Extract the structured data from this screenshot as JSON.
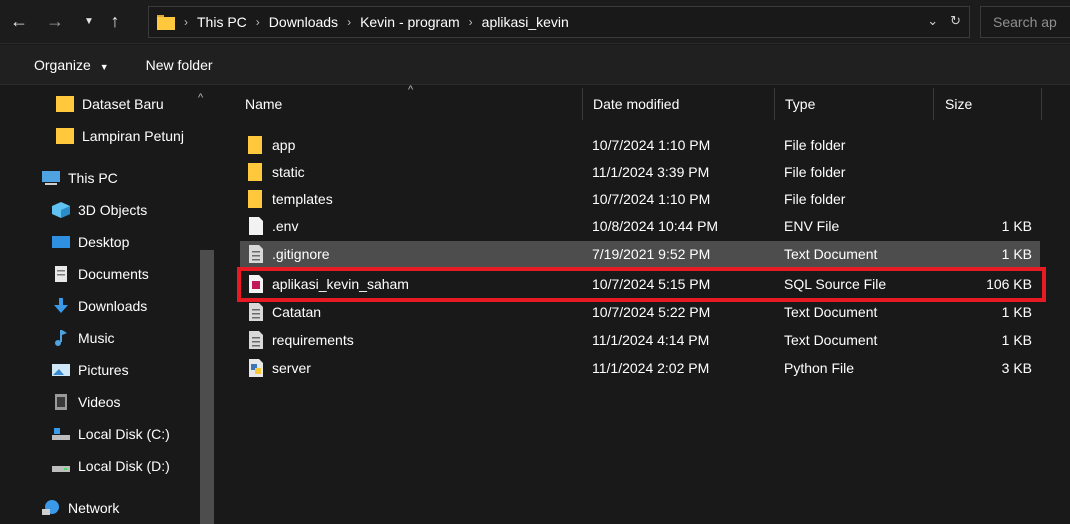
{
  "address": {
    "crumbs": [
      "This PC",
      "Downloads",
      "Kevin - program",
      "aplikasi_kevin"
    ],
    "search_placeholder": "Search ap"
  },
  "commands": {
    "organize": "Organize",
    "new_folder": "New folder"
  },
  "sidebar": {
    "items": [
      {
        "label": "Dataset Baru",
        "icon": "folder-icon"
      },
      {
        "label": "Lampiran Petunj",
        "icon": "folder-icon"
      },
      {
        "label": "This PC",
        "icon": "computer-icon"
      },
      {
        "label": "3D Objects",
        "icon": "cube-icon"
      },
      {
        "label": "Desktop",
        "icon": "desktop-icon"
      },
      {
        "label": "Documents",
        "icon": "document-icon"
      },
      {
        "label": "Downloads",
        "icon": "download-icon"
      },
      {
        "label": "Music",
        "icon": "music-icon"
      },
      {
        "label": "Pictures",
        "icon": "picture-icon"
      },
      {
        "label": "Videos",
        "icon": "video-icon"
      },
      {
        "label": "Local Disk (C:)",
        "icon": "drive-icon"
      },
      {
        "label": "Local Disk (D:)",
        "icon": "drive-icon"
      },
      {
        "label": "Network",
        "icon": "network-icon"
      }
    ]
  },
  "table": {
    "headers": {
      "name": "Name",
      "date": "Date modified",
      "type": "Type",
      "size": "Size"
    },
    "rows": [
      {
        "name": "app",
        "date": "10/7/2024 1:10 PM",
        "type": "File folder",
        "size": "",
        "icon": "folder-icon"
      },
      {
        "name": "static",
        "date": "11/1/2024 3:39 PM",
        "type": "File folder",
        "size": "",
        "icon": "folder-icon"
      },
      {
        "name": "templates",
        "date": "10/7/2024 1:10 PM",
        "type": "File folder",
        "size": "",
        "icon": "folder-icon"
      },
      {
        "name": ".env",
        "date": "10/8/2024 10:44 PM",
        "type": "ENV File",
        "size": "1 KB",
        "icon": "file-icon"
      },
      {
        "name": ".gitignore",
        "date": "7/19/2021 9:52 PM",
        "type": "Text Document",
        "size": "1 KB",
        "icon": "text-file-icon"
      },
      {
        "name": "aplikasi_kevin_saham",
        "date": "10/7/2024 5:15 PM",
        "type": "SQL Source File",
        "size": "106 KB",
        "icon": "sql-file-icon"
      },
      {
        "name": "Catatan",
        "date": "10/7/2024 5:22 PM",
        "type": "Text Document",
        "size": "1 KB",
        "icon": "text-file-icon"
      },
      {
        "name": "requirements",
        "date": "11/1/2024 4:14 PM",
        "type": "Text Document",
        "size": "1 KB",
        "icon": "text-file-icon"
      },
      {
        "name": "server",
        "date": "11/1/2024 2:02 PM",
        "type": "Python File",
        "size": "3 KB",
        "icon": "python-file-icon"
      }
    ]
  },
  "colors": {
    "background": "#191919",
    "selected_row": "#4d4d4d",
    "highlight_border": "#e81b24",
    "folder": "#ffc83d"
  }
}
